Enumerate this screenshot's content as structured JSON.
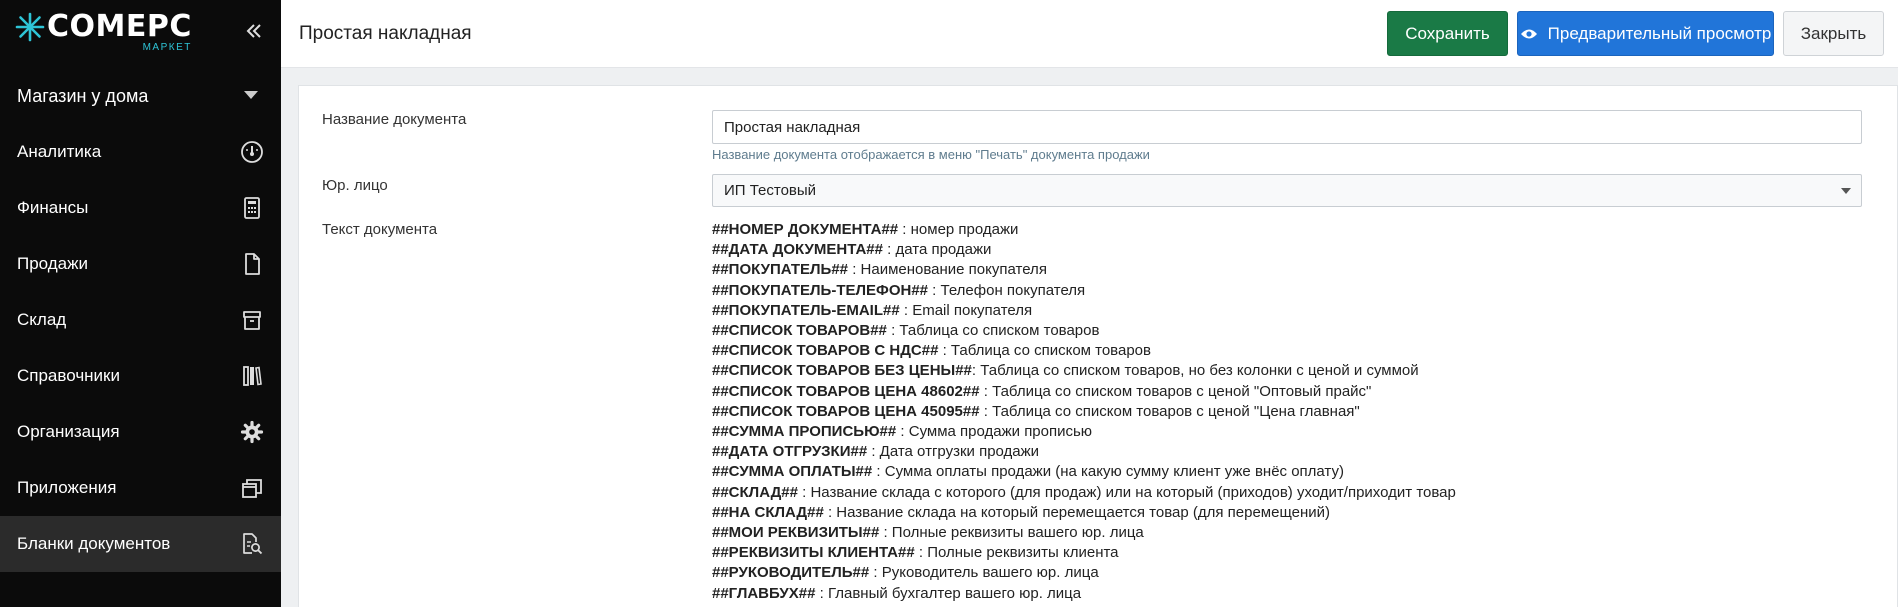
{
  "app": {
    "logo_word": "COMEPC",
    "logo_sub": "МАРКЕТ",
    "collapse_icon": "double-chevron-left-icon"
  },
  "sidebar": {
    "store": {
      "label": "Магазин у дома",
      "icon": "caret-down-icon"
    },
    "items": [
      {
        "label": "Аналитика",
        "icon": "gauge-icon",
        "active": false
      },
      {
        "label": "Финансы",
        "icon": "calculator-icon",
        "active": false
      },
      {
        "label": "Продажи",
        "icon": "document-icon",
        "active": false
      },
      {
        "label": "Склад",
        "icon": "box-icon",
        "active": false
      },
      {
        "label": "Справочники",
        "icon": "books-icon",
        "active": false
      },
      {
        "label": "Организация",
        "icon": "gear-icon",
        "active": false
      },
      {
        "label": "Приложения",
        "icon": "windows-icon",
        "active": false
      },
      {
        "label": "Бланки документов",
        "icon": "document-search-icon",
        "active": true
      }
    ]
  },
  "header": {
    "title": "Простая накладная",
    "save_label": "Сохранить",
    "preview_label": "Предварительный просмотр",
    "close_label": "Закрыть"
  },
  "form": {
    "name_label": "Название документа",
    "name_value": "Простая накладная",
    "name_hint": "Название документа отображается в меню \"Печать\" документа продажи",
    "entity_label": "Юр. лицо",
    "entity_value": "ИП Тестовый",
    "text_label": "Текст документа",
    "variables": [
      {
        "tag": "##НОМЕР ДОКУМЕНТА##",
        "desc": " : номер продажи"
      },
      {
        "tag": "##ДАТА ДОКУМЕНТА##",
        "desc": " : дата продажи"
      },
      {
        "tag": "##ПОКУПАТЕЛЬ##",
        "desc": " : Наименование покупателя"
      },
      {
        "tag": "##ПОКУПАТЕЛЬ-ТЕЛЕФОН##",
        "desc": " : Телефон покупателя"
      },
      {
        "tag": "##ПОКУПАТЕЛЬ-EMAIL##",
        "desc": " : Email покупателя"
      },
      {
        "tag": "##СПИСОК ТОВАРОВ##",
        "desc": " : Таблица со списком товаров"
      },
      {
        "tag": "##СПИСОК ТОВАРОВ С НДС##",
        "desc": " : Таблица со списком товаров"
      },
      {
        "tag": "##СПИСОК ТОВАРОВ БЕЗ ЦЕНЫ##",
        "desc": ": Таблица со списком товаров, но без колонки с ценой и суммой"
      },
      {
        "tag": "##СПИСОК ТОВАРОВ ЦЕНА 48602##",
        "desc": " : Таблица со списком товаров с ценой \"Оптовый прайс\""
      },
      {
        "tag": "##СПИСОК ТОВАРОВ ЦЕНА 45095##",
        "desc": " : Таблица со списком товаров с ценой \"Цена главная\""
      },
      {
        "tag": "##СУММА ПРОПИСЬЮ##",
        "desc": " : Сумма продажи прописью"
      },
      {
        "tag": "##ДАТА ОТГРУЗКИ##",
        "desc": " : Дата отгрузки продажи"
      },
      {
        "tag": "##СУММА ОПЛАТЫ##",
        "desc": " : Сумма оплаты продажи (на какую сумму клиент уже внёс оплату)"
      },
      {
        "tag": "##СКЛАД##",
        "desc": " : Название склада с которого (для продаж) или на который (приходов) уходит/приходит товар"
      },
      {
        "tag": "##НА СКЛАД##",
        "desc": " : Название склада на который перемещается товар (для перемещений)"
      },
      {
        "tag": "##МОИ РЕКВИЗИТЫ##",
        "desc": " : Полные реквизиты вашего юр. лица"
      },
      {
        "tag": "##РЕКВИЗИТЫ КЛИЕНТА##",
        "desc": " : Полные реквизиты клиента"
      },
      {
        "tag": "##РУКОВОДИТЕЛЬ##",
        "desc": " : Руководитель вашего юр. лица"
      },
      {
        "tag": "##ГЛАВБУХ##",
        "desc": " : Главный бухгалтер вашего юр. лица"
      }
    ]
  },
  "colors": {
    "sidebar_bg": "#0b0b0b",
    "save": "#1a7a46",
    "preview": "#2175d9",
    "logo_accent": "#2ec4d6"
  }
}
